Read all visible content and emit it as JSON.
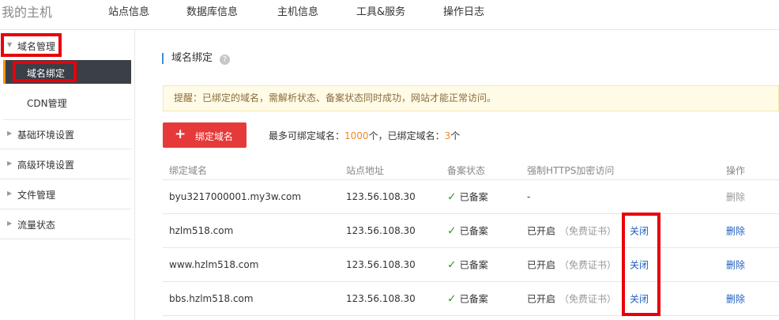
{
  "topnav": {
    "brand": "我的主机",
    "items": [
      "站点信息",
      "数据库信息",
      "主机信息",
      "工具&服务",
      "操作日志"
    ]
  },
  "sidebar": {
    "domain_group": "域名管理",
    "domain_bind": "域名绑定",
    "cdn": "CDN管理",
    "groups": [
      "基础环境设置",
      "高级环境设置",
      "文件管理",
      "流量状态"
    ]
  },
  "main": {
    "title": "域名绑定",
    "help_icon": "?",
    "notice": "提醒：已绑定的域名，需解析状态、备案状态同时成功，网站才能正常访问。",
    "bind_button": {
      "icon": "+",
      "label": "绑定域名"
    },
    "stats": {
      "max_label": "最多可绑定域名：",
      "max_value": "1000",
      "unit1": "个，已绑定域名：",
      "bound_value": "3",
      "unit2": "个"
    },
    "table": {
      "headers": [
        "绑定域名",
        "站点地址",
        "备案状态",
        "强制HTTPS加密访问",
        "操作"
      ],
      "rows": [
        {
          "domain": "byu3217000001.my3w.com",
          "ip": "123.56.108.30",
          "icp": "已备案",
          "https": "-",
          "cert": "",
          "toggle": "",
          "action": "删除",
          "action_enabled": false
        },
        {
          "domain": "hzlm518.com",
          "ip": "123.56.108.30",
          "icp": "已备案",
          "https": "已开启",
          "cert": "（免费证书）",
          "toggle": "关闭",
          "action": "删除",
          "action_enabled": true
        },
        {
          "domain": "www.hzlm518.com",
          "ip": "123.56.108.30",
          "icp": "已备案",
          "https": "已开启",
          "cert": "（免费证书）",
          "toggle": "关闭",
          "action": "删除",
          "action_enabled": true
        },
        {
          "domain": "bbs.hzlm518.com",
          "ip": "123.56.108.30",
          "icp": "已备案",
          "https": "已开启",
          "cert": "（免费证书）",
          "toggle": "关闭",
          "action": "删除",
          "action_enabled": true
        }
      ]
    }
  },
  "colors": {
    "highlight": "#e8000b",
    "accent_orange": "#f39800",
    "primary_red": "#e63939",
    "link_blue": "#1f5fbf",
    "check_green": "#2f9e2f"
  },
  "icons": {
    "check": "check-icon",
    "caret": "caret-icon",
    "help": "help-icon",
    "plus": "plus-icon"
  }
}
